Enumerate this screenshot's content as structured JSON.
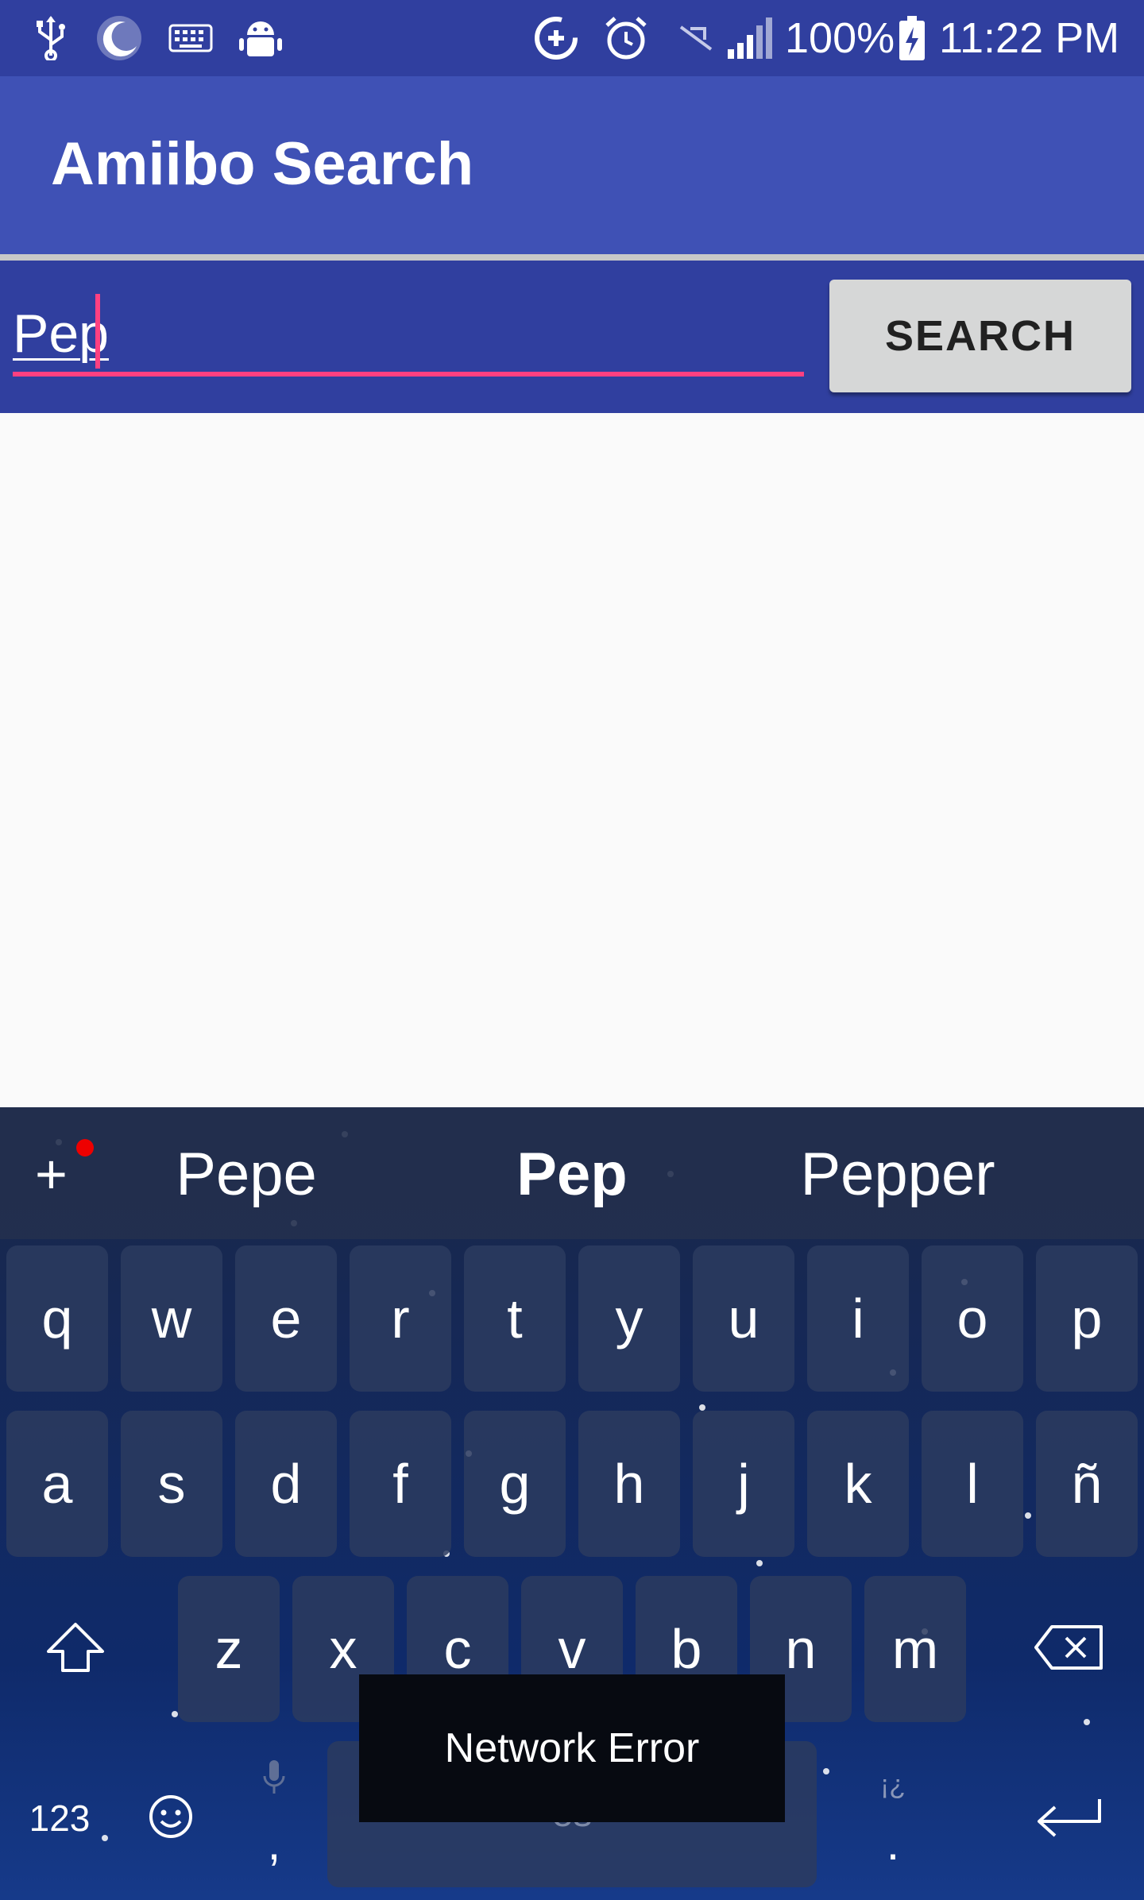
{
  "status_bar": {
    "icons": [
      "usb-icon",
      "night-mode-icon",
      "keyboard-icon",
      "android-debug-icon",
      "data-saver-icon",
      "alarm-icon",
      "no-sim-icon",
      "signal-icon",
      "battery-charging-icon"
    ],
    "battery": "100%",
    "time": "11:22 PM"
  },
  "app_bar": {
    "title": "Amiibo Search"
  },
  "search": {
    "value": "Pep",
    "button_label": "SEARCH"
  },
  "keyboard": {
    "suggestions": [
      "Pepe",
      "Pep",
      "Pepper"
    ],
    "rows": [
      [
        "q",
        "w",
        "e",
        "r",
        "t",
        "y",
        "u",
        "i",
        "o",
        "p"
      ],
      [
        "a",
        "s",
        "d",
        "f",
        "g",
        "h",
        "j",
        "k",
        "l",
        "ñ"
      ],
      [
        "z",
        "x",
        "c",
        "v",
        "b",
        "n",
        "m"
      ]
    ],
    "numbers_key": "123",
    "comma_key": ",",
    "period_key": ".",
    "punct_hint": "¡¿",
    "space_label": "es"
  },
  "toast": {
    "message": "Network Error"
  },
  "colors": {
    "primary": "#3f51b5",
    "primary_dark": "#303f9f",
    "accent": "#ff4081"
  }
}
